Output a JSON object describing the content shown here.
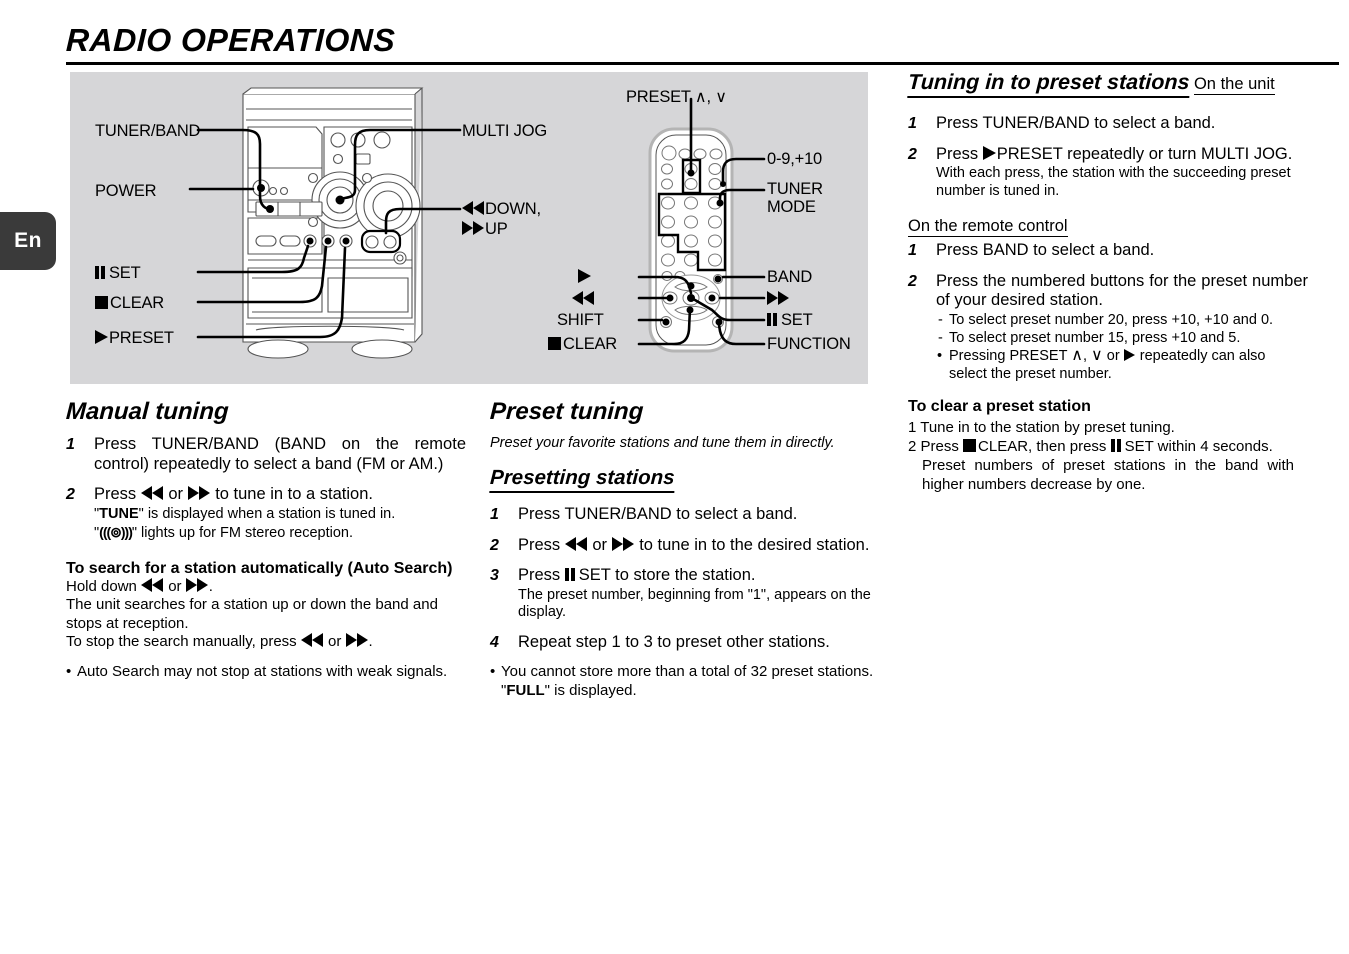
{
  "lang_tab": "En",
  "page_title": "RADIO OPERATIONS",
  "figure": {
    "unit_labels": {
      "tuner_band": "TUNER/BAND",
      "power": "POWER",
      "set": "SET",
      "clear": "CLEAR",
      "preset": "PRESET",
      "multi_jog": "MULTI JOG",
      "down": "DOWN,",
      "up": "UP"
    },
    "remote_labels": {
      "preset_updown": "PRESET",
      "preset_up_glyph": "∧",
      "preset_down_glyph": "∨",
      "numbers": "0-9,+10",
      "tuner_mode_l1": "TUNER",
      "tuner_mode_l2": "MODE",
      "band": "BAND",
      "set": "SET",
      "function": "FUNCTION",
      "shift": "SHIFT",
      "clear": "CLEAR"
    }
  },
  "manual_tuning": {
    "heading": "Manual tuning",
    "steps": [
      {
        "num": "1",
        "text": "Press TUNER/BAND (BAND on the remote control) repeatedly to select a band (FM or AM.)"
      },
      {
        "num": "2",
        "text": "Press ◀◀ or ▶▶ to tune in to a station."
      }
    ],
    "step2_note1_pre": "\"",
    "step2_note1_bold": "TUNE",
    "step2_note1_post": "\" is displayed when a station is tuned in.",
    "step2_note2_pre": "\"",
    "step2_note2_glyph": "(((⊚)))",
    "step2_note2_post": "\" lights up for FM stereo reception.",
    "auto_search_heading": "To search for a station automatically (Auto Search)",
    "auto_search_l1": "Hold down ◀◀ or ▶▶.",
    "auto_search_l2": "The unit searches for a station up or down the band and stops at reception.",
    "auto_search_l3": "To stop the search manually, press ◀◀ or ▶▶.",
    "auto_search_bullet": "Auto Search may not stop at stations with weak signals."
  },
  "preset_tuning": {
    "heading": "Preset tuning",
    "lead": "Preset your favorite stations and tune them in directly.",
    "sub_heading": "Presetting stations",
    "steps": [
      {
        "num": "1",
        "text": "Press TUNER/BAND to select a band."
      },
      {
        "num": "2",
        "text": "Press ◀◀ or ▶▶ to tune in to the desired station."
      },
      {
        "num": "3",
        "text": "Press SET to store the station."
      },
      {
        "num": "4",
        "text": "Repeat step 1 to 3 to preset other stations."
      }
    ],
    "step3_note": "The preset number, beginning from \"1\", appears on the display.",
    "bullet_pre": "You cannot store more than a total of 32 preset stations. \"",
    "bullet_bold": "FULL",
    "bullet_post": "\" is displayed."
  },
  "tuning_in": {
    "heading": "Tuning in to preset stations",
    "on_the_unit": "On the unit",
    "unit_steps": [
      {
        "num": "1",
        "text": "Press TUNER/BAND to select a band."
      },
      {
        "num": "2",
        "text": "Press PRESET repeatedly or turn MULTI JOG."
      }
    ],
    "unit_step2_note": "With each press, the station with the succeeding preset number is tuned in.",
    "on_the_remote": "On the remote control",
    "remote_steps": [
      {
        "num": "1",
        "text": "Press BAND to select a band."
      },
      {
        "num": "2",
        "text": "Press the numbered buttons for the preset number of your desired station."
      }
    ],
    "dash1": "To select preset number 20, press +10, +10 and 0.",
    "dash2": "To select preset number 15, press +10 and 5.",
    "bullet_pre": "Pressing PRESET",
    "bullet_mid": "or",
    "bullet_post": "repeatedly can also",
    "bullet_line2": "select the preset  number.",
    "clear_heading": "To clear a preset station",
    "clear_1": "1 Tune in to the station by preset tuning.",
    "clear_2_pre": "2 Press",
    "clear_2_mid": "CLEAR, then press",
    "clear_2_post": "SET within 4 seconds.",
    "clear_note": "Preset numbers of preset stations in the band with higher numbers decrease by one."
  },
  "colors": {
    "figure_bg": "#d6d6d8",
    "ink": "#000000",
    "tab_bg": "#3a3a3a"
  }
}
